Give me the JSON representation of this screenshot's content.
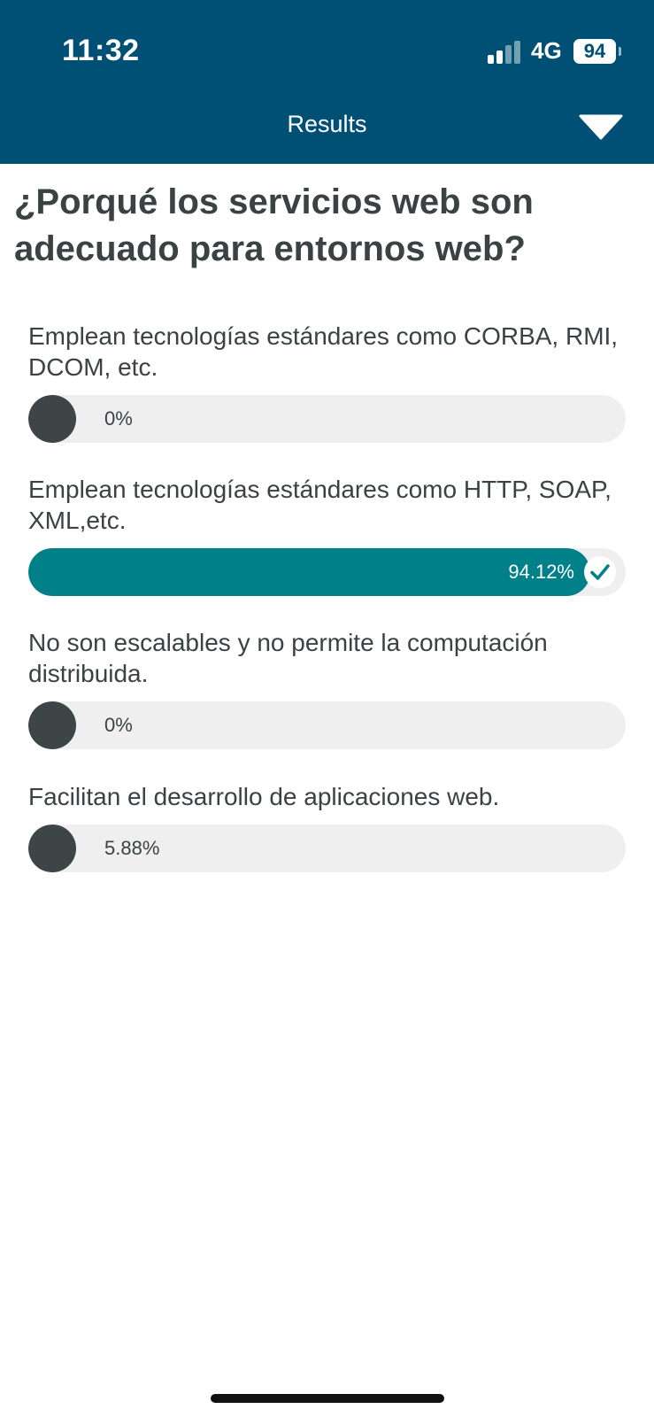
{
  "status_bar": {
    "time": "11:32",
    "network": "4G",
    "battery": "94"
  },
  "header": {
    "title": "Results",
    "menu_icon": "chevron-down-icon"
  },
  "question": "¿Porqué los servicios web son adecuado para entornos web?",
  "options": [
    {
      "label": "Emplean tecnologías estándares como CORBA, RMI, DCOM, etc.",
      "percent_text": "0%",
      "fraction": 0,
      "correct": false
    },
    {
      "label": "Emplean tecnologías estándares como HTTP, SOAP, XML,etc.",
      "percent_text": "94.12%",
      "fraction": 0.9412,
      "correct": true
    },
    {
      "label": "No son escalables y no permite la computación distribuida.",
      "percent_text": "0%",
      "fraction": 0,
      "correct": false
    },
    {
      "label": "Facilitan el desarrollo de aplicaciones web.",
      "percent_text": "5.88%",
      "fraction": 0.0588,
      "correct": false
    }
  ],
  "colors": {
    "header_bg": "#005075",
    "correct_fill": "#00818a",
    "default_fill": "#3d4547",
    "track": "#efefef"
  }
}
